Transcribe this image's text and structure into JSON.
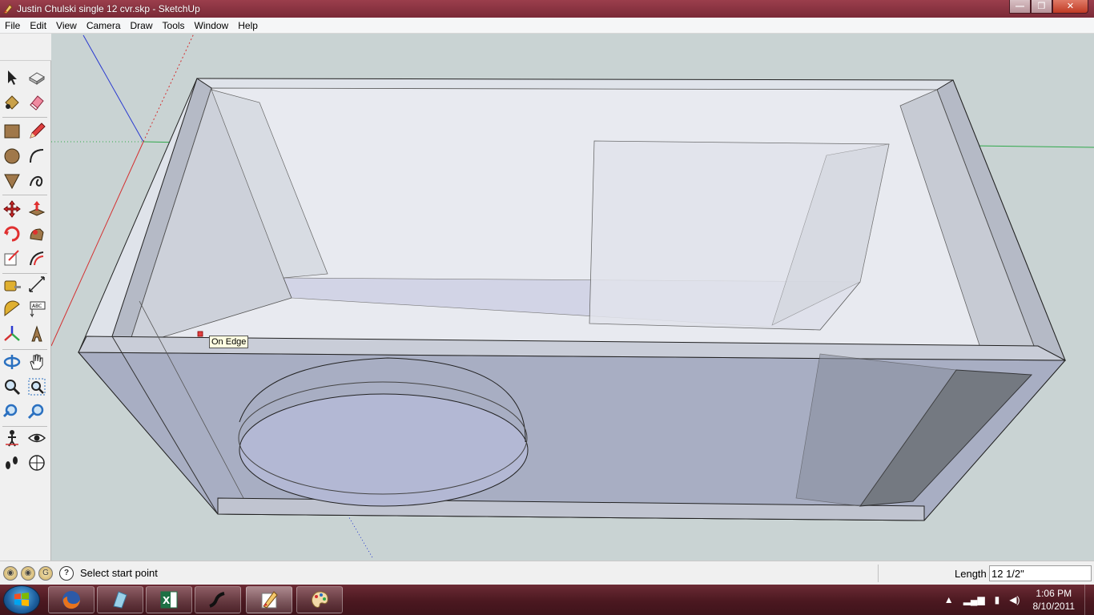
{
  "window": {
    "title": "Justin Chulski single 12 cvr.skp - SketchUp",
    "controls": {
      "minimize": "—",
      "maximize": "❐",
      "close": "✕"
    }
  },
  "menu": [
    "File",
    "Edit",
    "View",
    "Camera",
    "Draw",
    "Tools",
    "Window",
    "Help"
  ],
  "tools": [
    "select-icon",
    "make-component-icon",
    "paint-bucket-icon",
    "eraser-icon",
    "rectangle-icon",
    "pencil-line-icon",
    "circle-icon",
    "arc-icon",
    "polygon-icon",
    "freehand-icon",
    "move-icon",
    "push-pull-icon",
    "rotate-icon",
    "follow-me-icon",
    "scale-icon",
    "offset-icon",
    "tape-measure-icon",
    "dimension-icon",
    "protractor-icon",
    "text-icon",
    "axes-icon",
    "3d-text-icon",
    "orbit-icon",
    "pan-icon",
    "zoom-icon",
    "zoom-window-icon",
    "previous-view-icon",
    "zoom-extents-icon",
    "position-camera-icon",
    "look-around-icon",
    "walk-icon",
    "section-plane-icon"
  ],
  "viewport": {
    "tooltip": "On Edge",
    "background": "#c9d3d3"
  },
  "status": {
    "message": "Select start point",
    "vcb_label": "Length",
    "vcb_value": "12 1/2\""
  },
  "taskbar": {
    "apps": [
      "start",
      "firefox",
      "paint-tool",
      "excel",
      "media",
      "sketchup",
      "paint"
    ],
    "clock_time": "1:06 PM",
    "clock_date": "8/10/2011"
  },
  "colors": {
    "titlebar": "#8b3442",
    "taskbar": "#4b1820",
    "axis_red": "#d43030",
    "axis_green": "#2fa84a",
    "axis_blue": "#2a3ad0"
  }
}
